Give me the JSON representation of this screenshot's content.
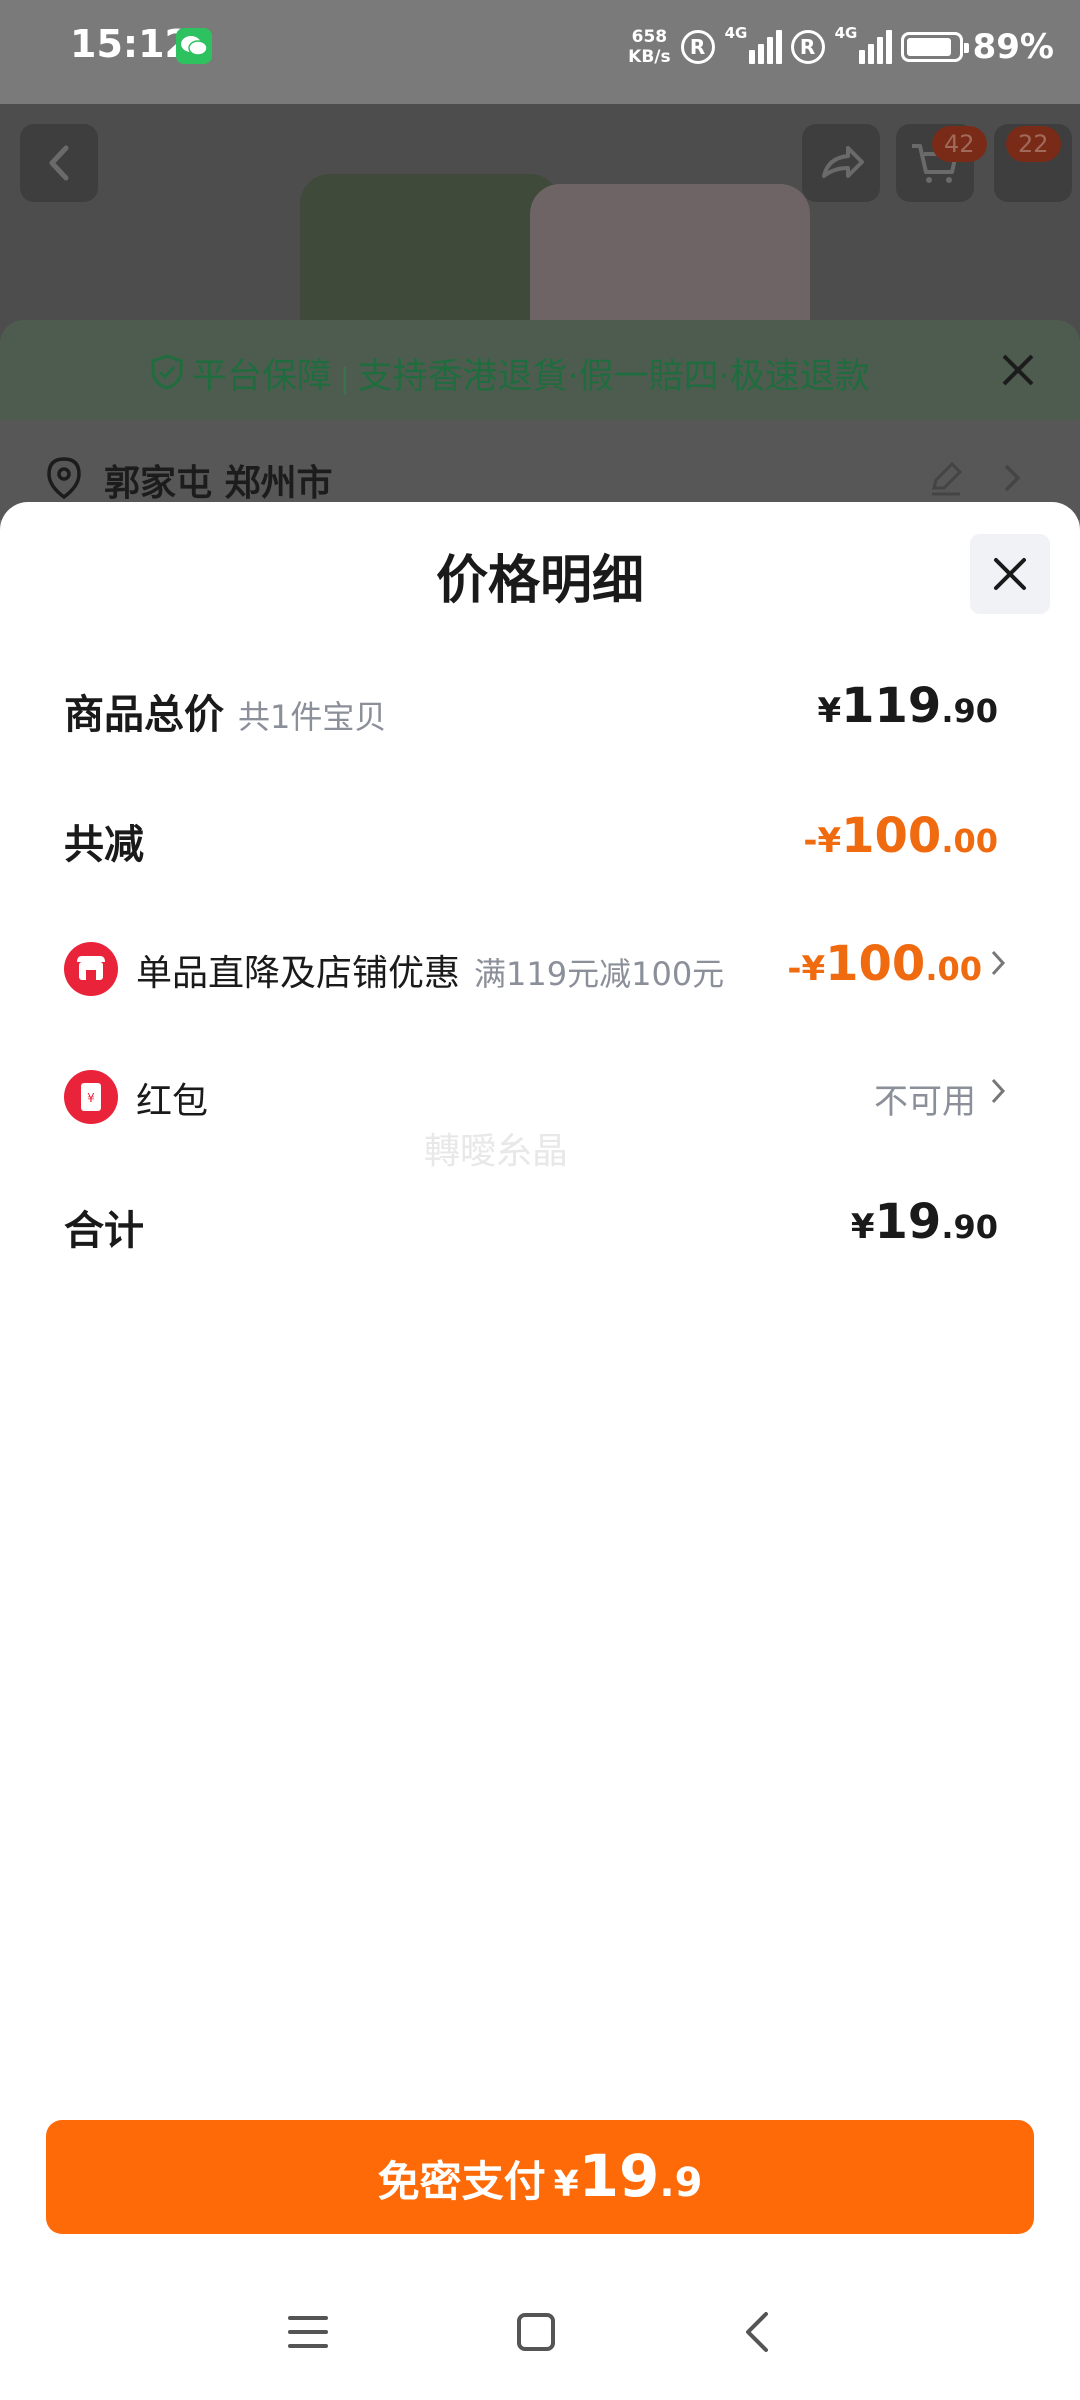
{
  "status_bar": {
    "time": "15:12",
    "net_speed_value": "658",
    "net_speed_unit": "KB/s",
    "roaming_1": "R",
    "network_1": "4G",
    "roaming_2": "R",
    "network_2": "4G",
    "battery": "89%",
    "battery_level": 0.89,
    "app_icon": "wechat-icon"
  },
  "background": {
    "cart_badge": "42",
    "message_badge": "22",
    "guarantee": {
      "label": "平台保障",
      "separator": "|",
      "text": "支持香港退貨·假一賠四·极速退款"
    },
    "address": "郭家屯 郑州市"
  },
  "sheet": {
    "title": "价格明细",
    "rows": {
      "total": {
        "label": "商品总价",
        "sub": "共1件宝贝",
        "currency": "¥",
        "int": "119",
        "dec": ".90"
      },
      "discount": {
        "label": "共减",
        "currency": "-¥",
        "int": "100",
        "dec": ".00"
      },
      "store": {
        "label": "单品直降及店铺优惠",
        "sub": "满119元减100元",
        "currency": "-¥",
        "int": "100",
        "dec": ".00"
      },
      "redpacket": {
        "label": "红包",
        "status": "不可用"
      },
      "sum": {
        "label": "合计",
        "currency": "¥",
        "int": "19",
        "dec": ".90"
      }
    },
    "watermark": "轉曖糸晶",
    "pay": {
      "label": "免密支付",
      "currency": "¥",
      "int": "19",
      "dec": ".9"
    }
  },
  "colors": {
    "accent": "#ff6a08",
    "discount": "#f06a0f",
    "red_icon": "#e9233a",
    "guarantee_green": "#1f6d3e"
  }
}
